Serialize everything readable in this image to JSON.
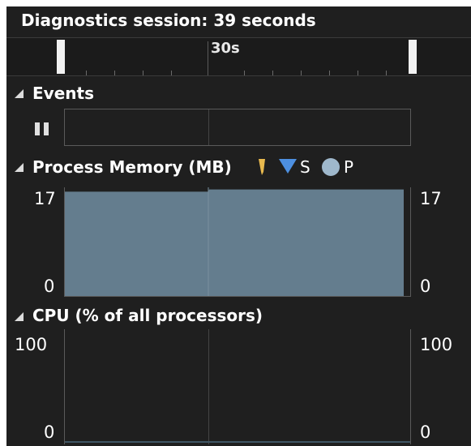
{
  "header": {
    "title": "Diagnostics session: 39 seconds"
  },
  "ruler": {
    "label": "30s"
  },
  "events": {
    "title": "Events"
  },
  "memory": {
    "title": "Process Memory (MB)",
    "legend": [
      {
        "icon": "gc-marker-icon",
        "label": "",
        "color": "#e8b94e"
      },
      {
        "icon": "snapshot-marker-icon",
        "label": "S",
        "color": "#4d8fe0"
      },
      {
        "icon": "private-bytes-marker-icon",
        "label": "P",
        "color": "#9fb8cc"
      }
    ],
    "axis_max_label": "17",
    "axis_min_label": "0",
    "fill_color": "#647d8e",
    "level_fraction_start": 0.96,
    "level_fraction_end": 0.98
  },
  "cpu": {
    "title": "CPU (% of all processors)",
    "axis_max_label": "100",
    "axis_min_label": "0"
  }
}
